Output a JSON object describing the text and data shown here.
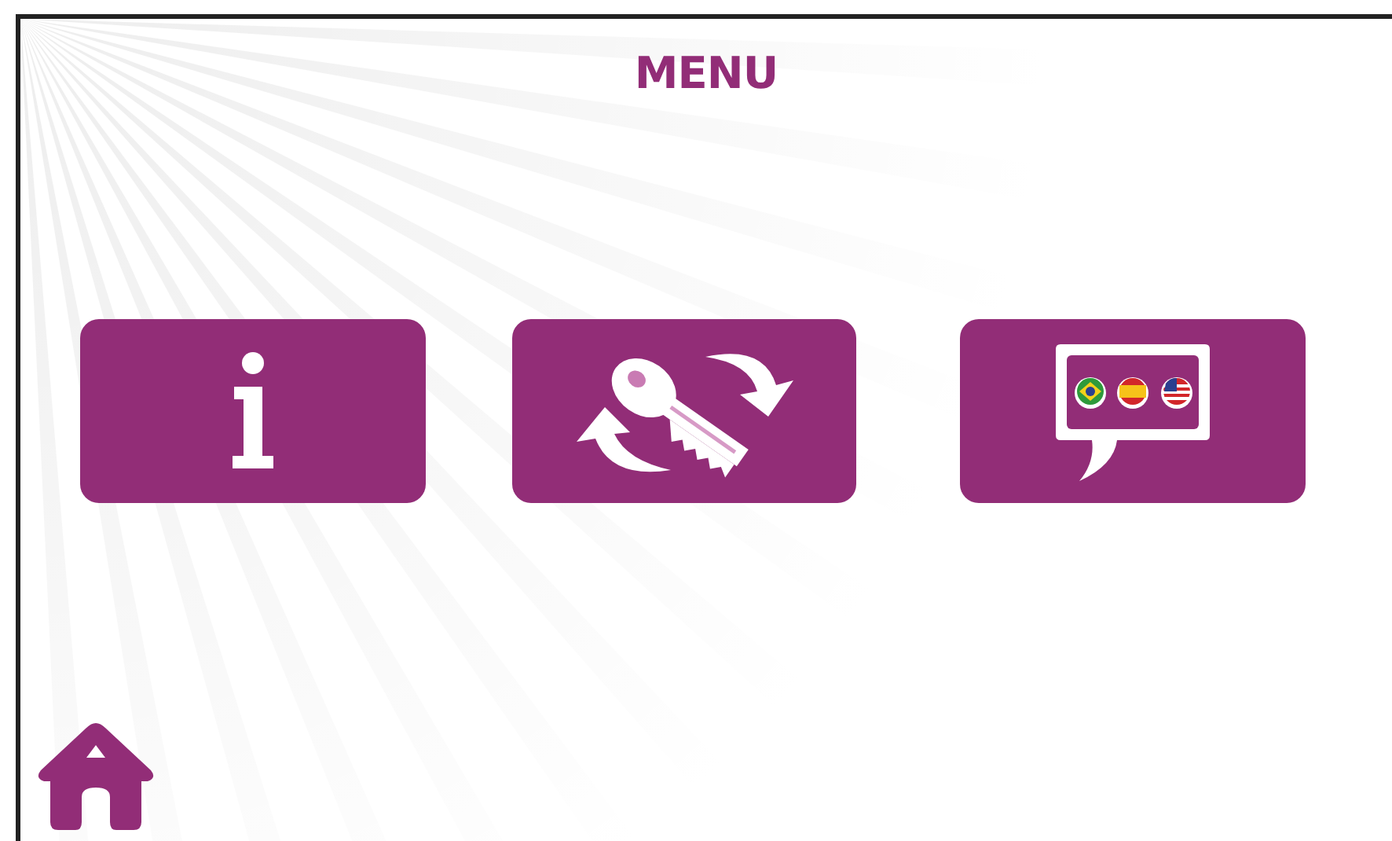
{
  "title": "MENU",
  "menu_buttons": [
    {
      "kind": "info"
    },
    {
      "kind": "key_swap"
    },
    {
      "kind": "language"
    }
  ]
}
